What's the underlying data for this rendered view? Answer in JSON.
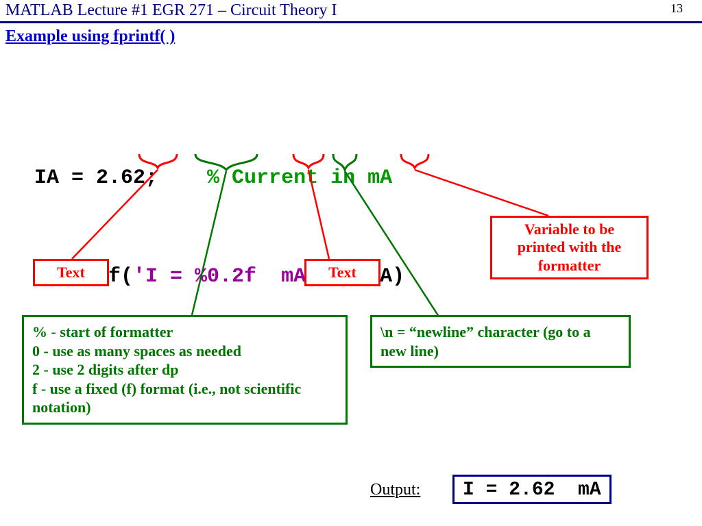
{
  "header": {
    "title": "MATLAB Lecture #1   EGR 271 – Circuit Theory I",
    "page": "13"
  },
  "section_title": "Example using fprintf( )",
  "code": {
    "line1_a": "IA = 2.62;    ",
    "line1_b": "% Current in mA",
    "line2_a": "fprintf(",
    "line2_b": "'I = %0.2f  mA\\n'",
    "line2_c": ", IA)"
  },
  "callouts": {
    "text1": "Text",
    "text2": "Text",
    "variable": "Variable to be printed with the formatter",
    "formatter": "% - start of formatter\n0 - use as many spaces as needed\n2 - use 2 digits after dp\nf - use a fixed (f) format (i.e., not scientific notation)",
    "newline": "\\n = “newline” character (go to a new line)"
  },
  "output": {
    "label": "Output",
    "value": "I = 2.62  mA"
  }
}
